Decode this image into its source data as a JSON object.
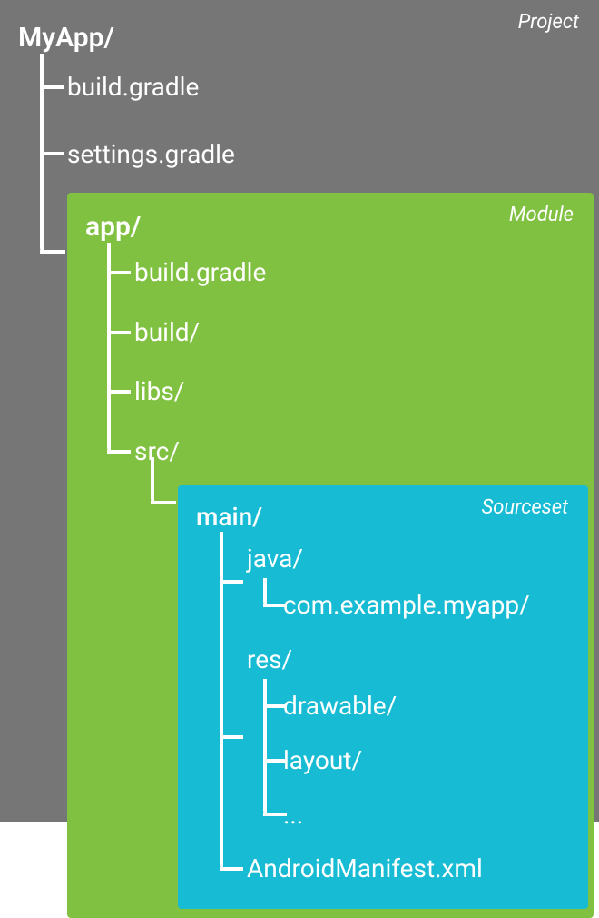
{
  "project": {
    "label": "Project",
    "name": "MyApp/",
    "children": [
      {
        "name": "build.gradle"
      },
      {
        "name": "settings.gradle"
      }
    ]
  },
  "module": {
    "label": "Module",
    "name": "app/",
    "children": [
      {
        "name": "build.gradle"
      },
      {
        "name": "build/"
      },
      {
        "name": "libs/"
      },
      {
        "name": "src/"
      }
    ]
  },
  "sourceset": {
    "label": "Sourceset",
    "name": "main/",
    "java": {
      "name": "java/",
      "pkg": "com.example.myapp/"
    },
    "res": {
      "name": "res/",
      "children": [
        {
          "name": "drawable/"
        },
        {
          "name": "layout/"
        },
        {
          "name": "..."
        }
      ]
    },
    "manifest": "AndroidManifest.xml"
  }
}
